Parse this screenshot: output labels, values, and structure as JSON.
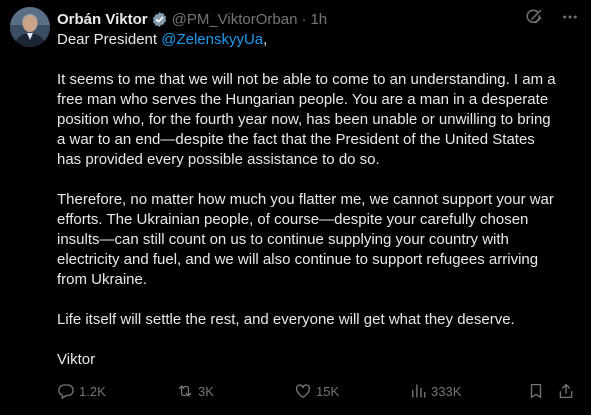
{
  "author": {
    "name": "Orbán Viktor",
    "handle": "@PM_ViktorOrban",
    "separator": "·",
    "time": "1h"
  },
  "tweet": {
    "greeting_prefix": "Dear President ",
    "mention": "@ZelenskyyUa",
    "greeting_suffix": ",",
    "paragraphs": [
      "It seems to me that we will not be able to come to an understanding. I am a\nfree man who serves the Hungarian people. You are a man in a desperate\nposition who, for the fourth year now, has been unable or unwilling to bring\na war to an end—despite the fact that the President of the United States\nhas provided every possible assistance to do so.",
      "Therefore, no matter how much you flatter me, we cannot support your war\nefforts. The Ukrainian people, of course—despite your carefully chosen\ninsults—can still count on us to continue supplying your country with\nelectricity and fuel, and we will also continue to support refugees arriving\nfrom Ukraine.",
      "Life itself will settle the rest, and everyone will get what they deserve.",
      "Viktor"
    ]
  },
  "metrics": {
    "replies": "1.2K",
    "reposts": "3K",
    "likes": "15K",
    "views": "333K"
  },
  "icons": {
    "verified": "verified-badge-icon",
    "grok": "grok-icon",
    "more": "more-icon",
    "reply": "reply-icon",
    "repost": "repost-icon",
    "like": "like-icon",
    "views": "views-icon",
    "bookmark": "bookmark-icon",
    "share": "share-icon"
  },
  "colors": {
    "background": "#000000",
    "text": "#e7e9ea",
    "muted": "#71767b",
    "link": "#1d9bf0"
  }
}
